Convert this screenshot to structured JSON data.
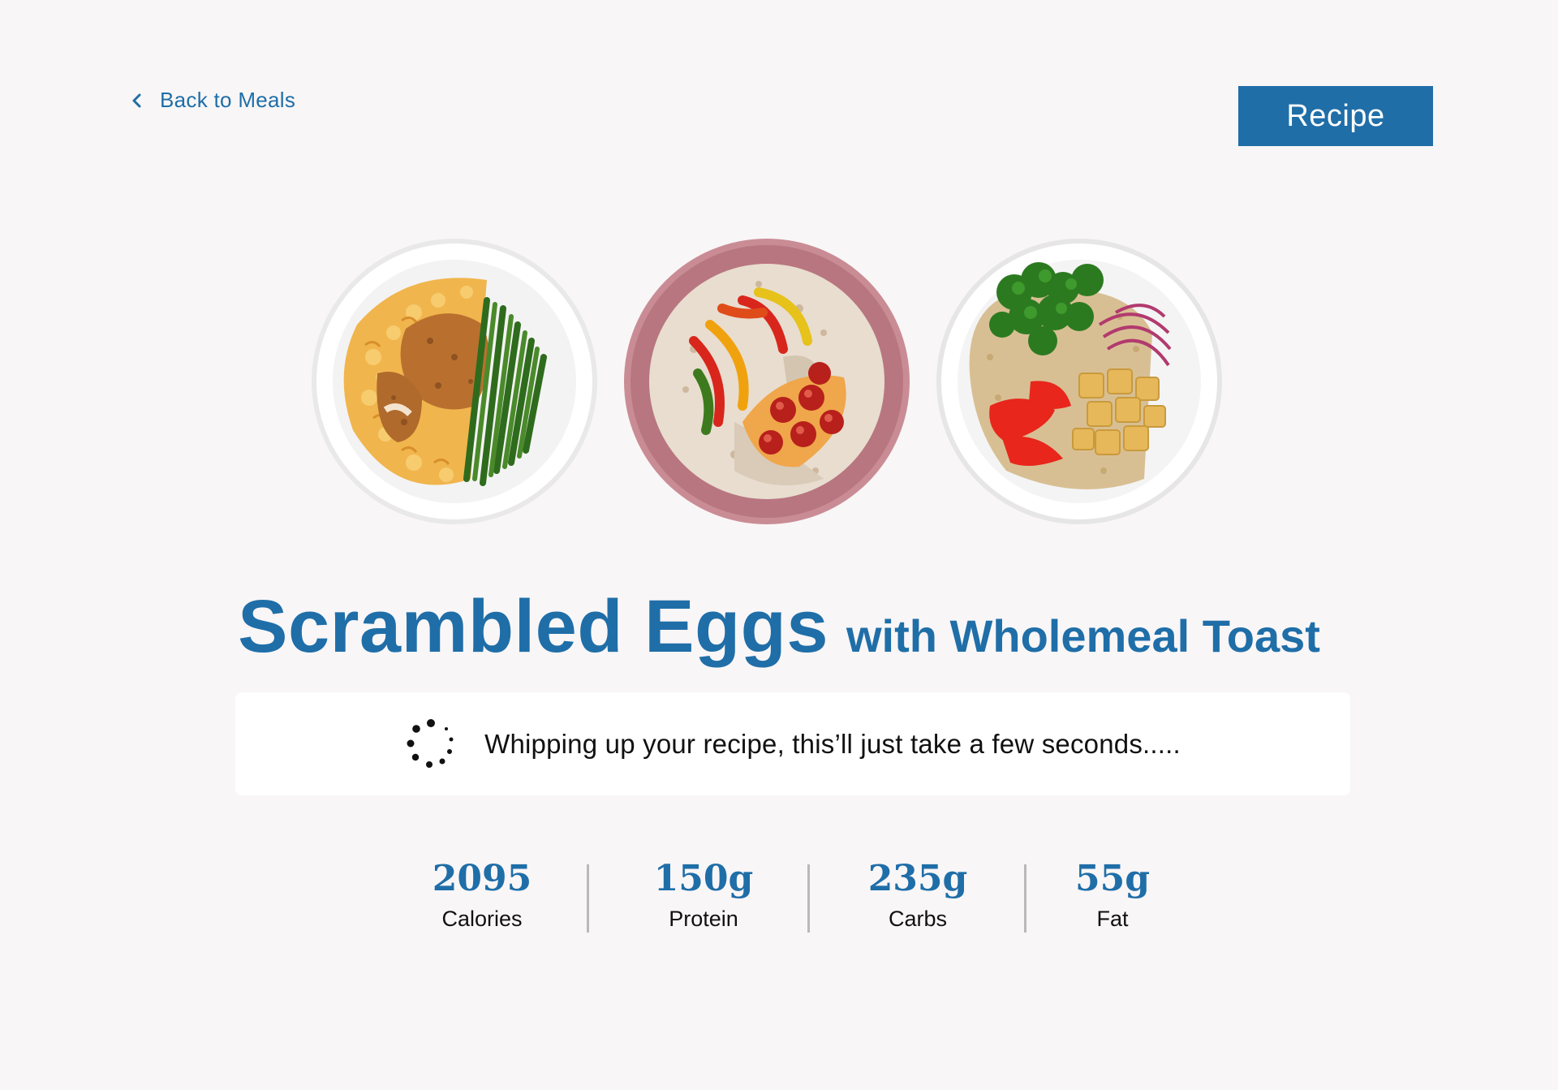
{
  "nav": {
    "back_label": "Back to Meals",
    "recipe_button": "Recipe"
  },
  "meal": {
    "title_main": "Scrambled Eggs",
    "title_sub": "with Wholemeal Toast"
  },
  "loading": {
    "message": "Whipping up your recipe, this’ll just take a few seconds....."
  },
  "nutrition": [
    {
      "value": "2095",
      "label": "Calories"
    },
    {
      "value": "150g",
      "label": "Protein"
    },
    {
      "value": "235g",
      "label": "Carbs"
    },
    {
      "value": "55g",
      "label": "Fat"
    }
  ],
  "colors": {
    "accent": "#1f6ea8",
    "background": "#f9f6f7",
    "divider": "#b9b9b9"
  },
  "images": [
    "mac-and-cheese-chicken-green-beans-plate",
    "rice-peppers-chicken-tomatoes-bowl",
    "rice-broccoli-tofu-peppers-bowl"
  ]
}
